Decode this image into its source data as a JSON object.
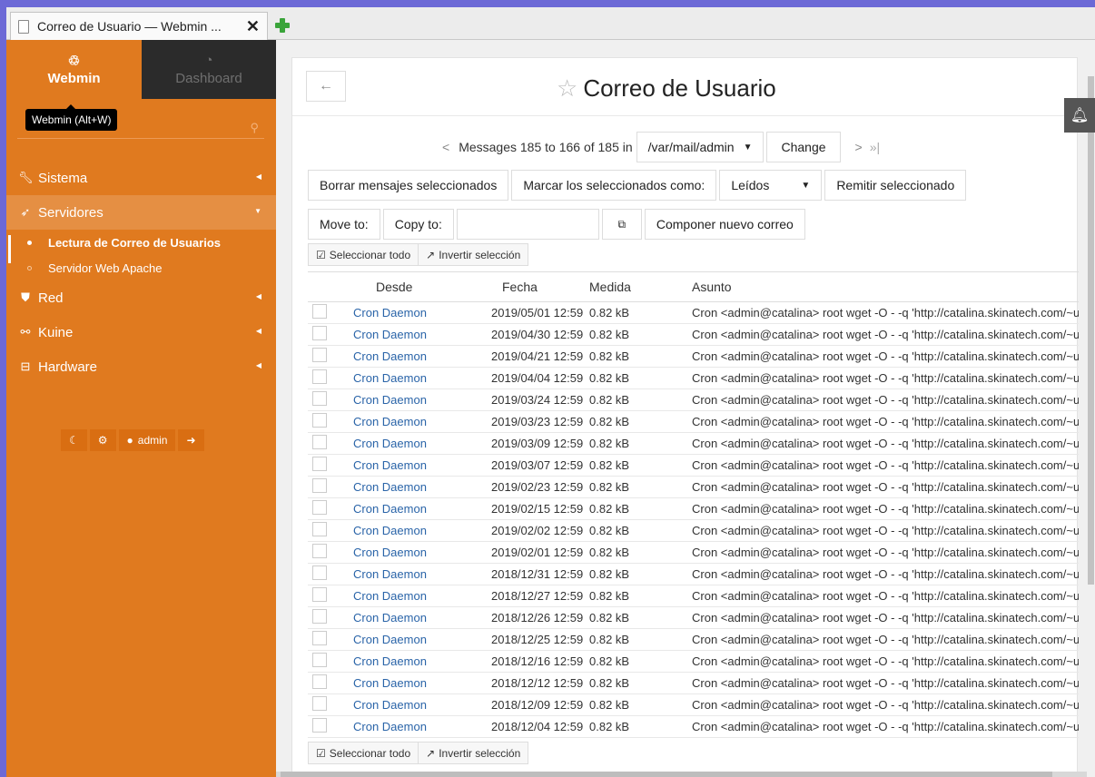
{
  "browser": {
    "tab_title": "Correo de Usuario — Webmin ...",
    "close_glyph": "✕"
  },
  "sidebar": {
    "tabs": [
      {
        "label": "Webmin",
        "icon": "webmin-logo-icon"
      },
      {
        "label": "Dashboard",
        "icon": "gauge-icon"
      }
    ],
    "tooltip": "Webmin (Alt+W)",
    "search_placeholder": "",
    "menu": [
      {
        "label": "Sistema",
        "icon": "wrench-icon"
      },
      {
        "label": "Servidores",
        "icon": "rocket-icon"
      },
      {
        "label": "Red",
        "icon": "shield-icon"
      },
      {
        "label": "Kuine",
        "icon": "cluster-icon"
      },
      {
        "label": "Hardware",
        "icon": "hdd-icon"
      }
    ],
    "submenu": [
      {
        "label": "Lectura de Correo de Usuarios"
      },
      {
        "label": "Servidor Web Apache"
      }
    ],
    "userbar": {
      "user": "admin"
    }
  },
  "page": {
    "title": "Correo de Usuario"
  },
  "nav": {
    "messages_label": "Messages 185 to 166 of 185 in",
    "folder": "/var/mail/admin",
    "change_label": "Change"
  },
  "actions": {
    "delete": "Borrar mensajes seleccionados",
    "mark_as": "Marcar los seleccionados como:",
    "mark_value": "Leídos",
    "forward": "Remitir seleccionado",
    "move_to": "Move to:",
    "copy_to": "Copy to:",
    "compose": "Componer nuevo correo",
    "select_all": "Seleccionar todo",
    "invert": "Invertir selección"
  },
  "table": {
    "headers": [
      "Desde",
      "Fecha",
      "Medida",
      "Asunto"
    ],
    "rows": [
      {
        "from": "Cron Daemon",
        "date": "2019/05/01 12:59",
        "size": "0.82 kB",
        "subject": "Cron <admin@catalina> root wget -O - -q 'http://catalina.skinatech.com/~unia"
      },
      {
        "from": "Cron Daemon",
        "date": "2019/04/30 12:59",
        "size": "0.82 kB",
        "subject": "Cron <admin@catalina> root wget -O - -q 'http://catalina.skinatech.com/~unia"
      },
      {
        "from": "Cron Daemon",
        "date": "2019/04/21 12:59",
        "size": "0.82 kB",
        "subject": "Cron <admin@catalina> root wget -O - -q 'http://catalina.skinatech.com/~unia"
      },
      {
        "from": "Cron Daemon",
        "date": "2019/04/04 12:59",
        "size": "0.82 kB",
        "subject": "Cron <admin@catalina> root wget -O - -q 'http://catalina.skinatech.com/~unia"
      },
      {
        "from": "Cron Daemon",
        "date": "2019/03/24 12:59",
        "size": "0.82 kB",
        "subject": "Cron <admin@catalina> root wget -O - -q 'http://catalina.skinatech.com/~unia"
      },
      {
        "from": "Cron Daemon",
        "date": "2019/03/23 12:59",
        "size": "0.82 kB",
        "subject": "Cron <admin@catalina> root wget -O - -q 'http://catalina.skinatech.com/~unia"
      },
      {
        "from": "Cron Daemon",
        "date": "2019/03/09 12:59",
        "size": "0.82 kB",
        "subject": "Cron <admin@catalina> root wget -O - -q 'http://catalina.skinatech.com/~unia"
      },
      {
        "from": "Cron Daemon",
        "date": "2019/03/07 12:59",
        "size": "0.82 kB",
        "subject": "Cron <admin@catalina> root wget -O - -q 'http://catalina.skinatech.com/~unia"
      },
      {
        "from": "Cron Daemon",
        "date": "2019/02/23 12:59",
        "size": "0.82 kB",
        "subject": "Cron <admin@catalina> root wget -O - -q 'http://catalina.skinatech.com/~unia"
      },
      {
        "from": "Cron Daemon",
        "date": "2019/02/15 12:59",
        "size": "0.82 kB",
        "subject": "Cron <admin@catalina> root wget -O - -q 'http://catalina.skinatech.com/~unia"
      },
      {
        "from": "Cron Daemon",
        "date": "2019/02/02 12:59",
        "size": "0.82 kB",
        "subject": "Cron <admin@catalina> root wget -O - -q 'http://catalina.skinatech.com/~unia"
      },
      {
        "from": "Cron Daemon",
        "date": "2019/02/01 12:59",
        "size": "0.82 kB",
        "subject": "Cron <admin@catalina> root wget -O - -q 'http://catalina.skinatech.com/~unia"
      },
      {
        "from": "Cron Daemon",
        "date": "2018/12/31 12:59",
        "size": "0.82 kB",
        "subject": "Cron <admin@catalina> root wget -O - -q 'http://catalina.skinatech.com/~unia"
      },
      {
        "from": "Cron Daemon",
        "date": "2018/12/27 12:59",
        "size": "0.82 kB",
        "subject": "Cron <admin@catalina> root wget -O - -q 'http://catalina.skinatech.com/~unia"
      },
      {
        "from": "Cron Daemon",
        "date": "2018/12/26 12:59",
        "size": "0.82 kB",
        "subject": "Cron <admin@catalina> root wget -O - -q 'http://catalina.skinatech.com/~unia"
      },
      {
        "from": "Cron Daemon",
        "date": "2018/12/25 12:59",
        "size": "0.82 kB",
        "subject": "Cron <admin@catalina> root wget -O - -q 'http://catalina.skinatech.com/~unia"
      },
      {
        "from": "Cron Daemon",
        "date": "2018/12/16 12:59",
        "size": "0.82 kB",
        "subject": "Cron <admin@catalina> root wget -O - -q 'http://catalina.skinatech.com/~unia"
      },
      {
        "from": "Cron Daemon",
        "date": "2018/12/12 12:59",
        "size": "0.82 kB",
        "subject": "Cron <admin@catalina> root wget -O - -q 'http://catalina.skinatech.com/~unia"
      },
      {
        "from": "Cron Daemon",
        "date": "2018/12/09 12:59",
        "size": "0.82 kB",
        "subject": "Cron <admin@catalina> root wget -O - -q 'http://catalina.skinatech.com/~unia"
      },
      {
        "from": "Cron Daemon",
        "date": "2018/12/04 12:59",
        "size": "0.82 kB",
        "subject": "Cron <admin@catalina> root wget -O - -q 'http://catalina.skinatech.com/~unia"
      }
    ]
  },
  "colors": {
    "sidebar": "#e07a1f",
    "link": "#2a64a8",
    "frame": "#6c69d6"
  }
}
